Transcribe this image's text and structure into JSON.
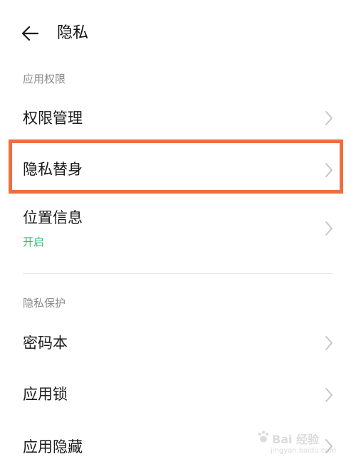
{
  "header": {
    "title": "隐私"
  },
  "sections": [
    {
      "label": "应用权限",
      "items": [
        {
          "label": "权限管理"
        },
        {
          "label": "隐私替身"
        },
        {
          "label": "位置信息",
          "sub": "开启"
        }
      ]
    },
    {
      "label": "隐私保护",
      "items": [
        {
          "label": "密码本"
        },
        {
          "label": "应用锁"
        },
        {
          "label": "应用隐藏"
        }
      ]
    }
  ],
  "colors": {
    "highlight": "#ef6e3d",
    "status_on": "#2fbf71",
    "section_label": "#8a8a8a"
  },
  "icons": {
    "back": "arrow-left-icon",
    "chevron": "chevron-right-icon"
  },
  "watermark": {
    "text": "Bai 经验",
    "sub": "jingyan.baidu.com"
  }
}
